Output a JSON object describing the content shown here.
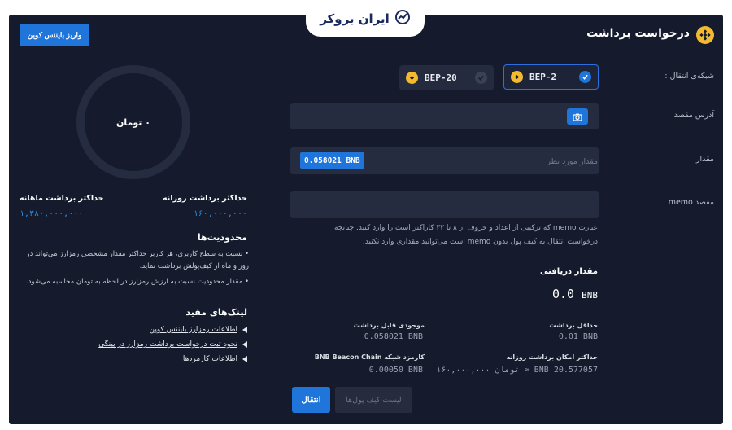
{
  "logo": {
    "text": "ایران بروکر",
    "icon": "chart-trend-icon"
  },
  "header": {
    "title": "درخواست برداشت",
    "deposit_button": "واریز بایننس کوین"
  },
  "network": {
    "label": "شبکه‌ی انتقال :",
    "options": [
      {
        "name": "BEP-2",
        "selected": true
      },
      {
        "name": "BEP-20",
        "selected": false
      }
    ]
  },
  "address": {
    "label": "آدرس مقصد",
    "value": "",
    "icon": "camera-icon"
  },
  "amount": {
    "label": "مقدار",
    "placeholder": "مقدار مورد نظر",
    "balance_tag": "0.058021 BNB"
  },
  "memo": {
    "label": "memo مقصد",
    "value": "",
    "note": "عبارت memo که ترکیبی از اعداد و حروف از ۸ تا ۳۲ کاراکتر است را وارد کنید. چنانچه درخواست انتقال به کیف پول بدون memo است می‌توانید مقداری وارد نکنید."
  },
  "received": {
    "label": "مقدار دریافتی",
    "value": "0.0",
    "unit": "BNB"
  },
  "stats": {
    "min_withdraw_label": "حداقل برداشت",
    "min_withdraw_value": "0.01 BNB",
    "balance_label": "موجودی قابل برداشت",
    "balance_value": "0.058021 BNB",
    "max_daily_label": "حداکثر امکان برداشت روزانه",
    "max_daily_value": "20.577057 BNB ≈ تومان ۱۶۰,۰۰۰,۰۰۰",
    "fee_label": "کارمزد شبکه BNB Beacon Chain",
    "fee_value": "0.00050 BNB"
  },
  "actions": {
    "wallet_list": "لیست کیف پول‌ها",
    "transfer": "انتقال"
  },
  "sidebar": {
    "ring_text": "۰ تومان",
    "daily_label": "حداکثر برداشت روزانه",
    "daily_value": "۱۶۰,۰۰۰,۰۰۰",
    "monthly_label": "حداکثر برداشت ماهانه",
    "monthly_value": "۱,۳۸۰,۰۰۰,۰۰۰",
    "limits_title": "محدودیت‌ها",
    "limits": [
      "نسبت به سطح کاربری، هر کاربر حداکثر مقدار مشخصی رمزارز می‌تواند در روز و ماه از کیف‌پولش برداشت نماید.",
      "مقدار محدودیت نسبت به ارزش رمزارز در لحظه به تومان محاسبه می‌شود."
    ],
    "links_title": "لینک‌های مفید",
    "links": [
      "اطلاعات رمزارز بایننس کوین",
      "نحوه ثبت درخواست برداشت رمزارز در پینگی",
      "اطلاعات کارمزدها"
    ]
  },
  "colors": {
    "background": "#151b2c",
    "accent": "#1f75d9",
    "bnb": "#f3ba2f",
    "field": "#252c3f"
  }
}
